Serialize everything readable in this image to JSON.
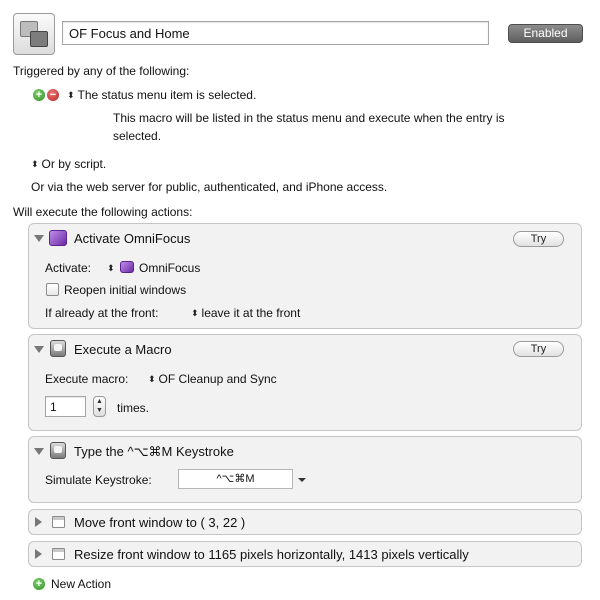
{
  "header": {
    "macro_name": "OF Focus and Home",
    "enabled_label": "Enabled",
    "icon": "macro-group-icon"
  },
  "triggers": {
    "heading": "Triggered by any of the following:",
    "status_menu_trigger": "The status menu item is selected.",
    "status_menu_description_line1": "This macro will be listed in the status menu and execute when the entry is",
    "status_menu_description_line2": "selected.",
    "script_trigger": "Or by script.",
    "web_server_note": "Or via the web server for public, authenticated, and iPhone access."
  },
  "actions_heading": "Will execute the following actions:",
  "actions": [
    {
      "title": "Activate OmniFocus",
      "icon": "omnifocus-icon",
      "expanded": true,
      "try_label": "Try",
      "activate_label": "Activate:",
      "activate_app": "OmniFocus",
      "reopen_label": "Reopen initial windows",
      "reopen_checked": false,
      "front_label": "If already at the front:",
      "front_value": "leave it at the front"
    },
    {
      "title": "Execute a Macro",
      "icon": "macro-icon",
      "expanded": true,
      "try_label": "Try",
      "execute_label": "Execute macro:",
      "execute_value": "OF Cleanup and Sync",
      "times_value": "1",
      "times_label": "times."
    },
    {
      "title": "Type the ^⌥⌘M Keystroke",
      "icon": "keystroke-icon",
      "expanded": true,
      "simulate_label": "Simulate Keystroke:",
      "keystroke_value": "^⌥⌘M"
    },
    {
      "title": "Move front window to ( 3, 22 )",
      "icon": "window-icon",
      "expanded": false
    },
    {
      "title": "Resize front window to 1165 pixels horizontally, 1413 pixels vertically",
      "icon": "window-icon",
      "expanded": false
    }
  ],
  "new_action_label": "New Action",
  "colors": {
    "enabled_button": "#6f6f6f",
    "panel_background": "#f2f2f2",
    "add_green": "#3c9e2f",
    "remove_red": "#c62828",
    "omnifocus_purple": "#7b3ab8"
  }
}
